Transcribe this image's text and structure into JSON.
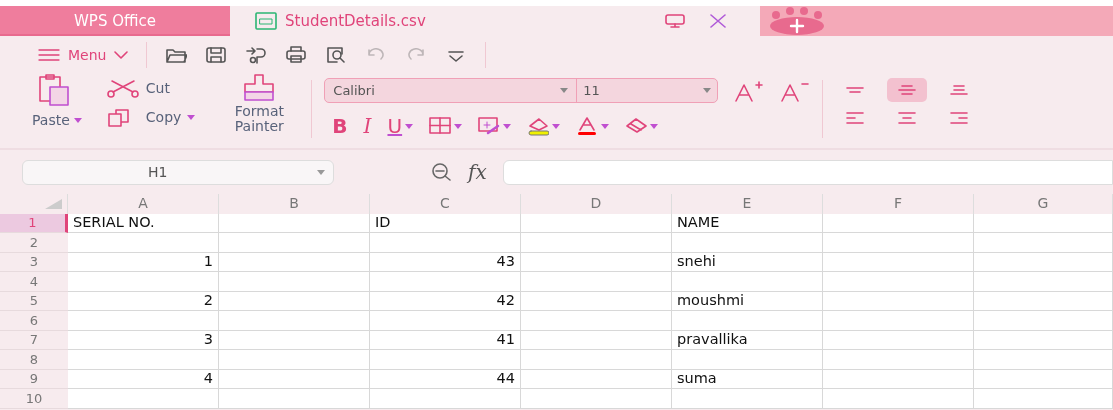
{
  "tabs": [
    {
      "kind": "home",
      "label": "WPS Office",
      "selected": false
    },
    {
      "kind": "document",
      "label": "StudentDetails.csv",
      "selected": true
    }
  ],
  "quick_toolbar": [
    {
      "kind": "menu",
      "label": "Menu"
    },
    {
      "kind": "open",
      "disabled": false
    },
    {
      "kind": "save",
      "disabled": false
    },
    {
      "kind": "export",
      "disabled": false
    },
    {
      "kind": "print",
      "disabled": false
    },
    {
      "kind": "preview",
      "disabled": false
    },
    {
      "kind": "undo",
      "disabled": true
    },
    {
      "kind": "redo",
      "disabled": true
    },
    {
      "kind": "more",
      "disabled": false
    }
  ],
  "ribbon": {
    "paste": "Paste",
    "cut": "Cut",
    "copy": "Copy",
    "format_painter": "Format Painter",
    "font": "Calibri",
    "font_size": "11",
    "format_buttons": [
      {
        "kind": "bold",
        "label": "B"
      },
      {
        "kind": "italic",
        "label": "I"
      },
      {
        "kind": "underline",
        "label": "U"
      },
      {
        "kind": "borders"
      },
      {
        "kind": "fill-format"
      },
      {
        "kind": "fill-color"
      },
      {
        "kind": "font-color"
      },
      {
        "kind": "clear"
      }
    ],
    "align_buttons": [
      {
        "kind": "top",
        "selected": false
      },
      {
        "kind": "middle",
        "selected": true
      },
      {
        "kind": "bottom",
        "selected": false
      },
      {
        "kind": "left",
        "selected": false
      },
      {
        "kind": "center",
        "selected": false
      },
      {
        "kind": "right",
        "selected": false
      }
    ]
  },
  "formula_bar": {
    "name_box": "H1",
    "fx": "fx"
  },
  "columns": [
    {
      "label": "A",
      "selected": false
    },
    {
      "label": "B",
      "selected": false
    },
    {
      "label": "C",
      "selected": false
    },
    {
      "label": "D",
      "selected": false
    },
    {
      "label": "E",
      "selected": false
    },
    {
      "label": "F",
      "selected": false
    },
    {
      "label": "G",
      "selected": false
    }
  ],
  "rows": [
    {
      "label": "1",
      "selected": true,
      "cells": [
        {
          "text": "SERIAL NO.",
          "kind": "text"
        },
        null,
        {
          "text": "ID",
          "kind": "text"
        },
        null,
        {
          "text": "NAME",
          "kind": "text"
        },
        null,
        null
      ]
    },
    {
      "label": "2",
      "selected": false,
      "cells": []
    },
    {
      "label": "3",
      "selected": false,
      "cells": [
        {
          "text": "1",
          "kind": "number"
        },
        null,
        {
          "text": "43",
          "kind": "number"
        },
        null,
        {
          "text": "snehi",
          "kind": "text"
        },
        null,
        null
      ]
    },
    {
      "label": "4",
      "selected": false,
      "cells": []
    },
    {
      "label": "5",
      "selected": false,
      "cells": [
        {
          "text": "2",
          "kind": "number"
        },
        null,
        {
          "text": "42",
          "kind": "number"
        },
        null,
        {
          "text": "moushmi",
          "kind": "text"
        },
        null,
        null
      ]
    },
    {
      "label": "6",
      "selected": false,
      "cells": []
    },
    {
      "label": "7",
      "selected": false,
      "cells": [
        {
          "text": "3",
          "kind": "number"
        },
        null,
        {
          "text": "41",
          "kind": "number"
        },
        null,
        {
          "text": "pravallika",
          "kind": "text"
        },
        null,
        null
      ]
    },
    {
      "label": "8",
      "selected": false,
      "cells": []
    },
    {
      "label": "9",
      "selected": false,
      "cells": [
        {
          "text": "4",
          "kind": "number"
        },
        null,
        {
          "text": "44",
          "kind": "number"
        },
        null,
        {
          "text": "suma",
          "kind": "text"
        },
        null,
        null
      ]
    },
    {
      "label": "10",
      "selected": false,
      "cells": []
    }
  ]
}
